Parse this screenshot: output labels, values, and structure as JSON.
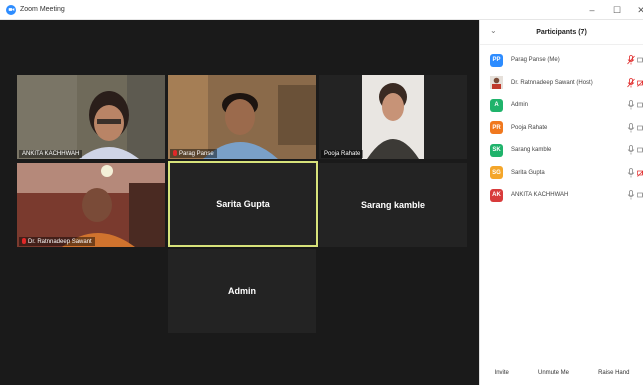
{
  "window": {
    "title": "Zoom Meeting",
    "minimize": "–",
    "maximize": "☐",
    "close": "✕"
  },
  "tiles": [
    {
      "name": "ANKITA KACHHWAH",
      "mic_muted": false,
      "has_video": true
    },
    {
      "name": "Parag Panse",
      "mic_muted": true,
      "has_video": true
    },
    {
      "name": "Pooja Rahate",
      "mic_muted": false,
      "has_video": true
    },
    {
      "name": "Dr. Ratnnadeep Sawant",
      "mic_muted": true,
      "has_video": true
    },
    {
      "name": "Sarita Gupta",
      "has_video": false,
      "active_speaker": true
    },
    {
      "name": "Sarang kamble",
      "has_video": false
    },
    {
      "name": "Admin",
      "has_video": false
    }
  ],
  "participants": {
    "title": "Participants (7)",
    "items": [
      {
        "initials": "PP",
        "name": "Parag Panse (Me)",
        "color": "#2d8cff",
        "mic_muted": true,
        "video_off": false
      },
      {
        "initials": "",
        "name": "Dr. Ratnnadeep Sawant (Host)",
        "color": "#c0392b",
        "mic_muted": true,
        "video_off": true,
        "photo_avatar": true
      },
      {
        "initials": "A",
        "name": "Admin",
        "color": "#1fb36b",
        "mic_muted": false,
        "video_off": false
      },
      {
        "initials": "PR",
        "name": "Pooja Rahate",
        "color": "#f0781e",
        "mic_muted": false,
        "video_off": false
      },
      {
        "initials": "SK",
        "name": "Sarang kamble",
        "color": "#1fb36b",
        "mic_muted": false,
        "video_off": false
      },
      {
        "initials": "SG",
        "name": "Sarita Gupta",
        "color": "#f4a62a",
        "mic_muted": false,
        "video_off": true
      },
      {
        "initials": "AK",
        "name": "ANKITA KACHHWAH",
        "color": "#d83b3b",
        "mic_muted": false,
        "video_off": false
      }
    ],
    "buttons": {
      "invite": "Invite",
      "unmute": "Unmute Me",
      "raise_hand": "Raise Hand"
    }
  }
}
